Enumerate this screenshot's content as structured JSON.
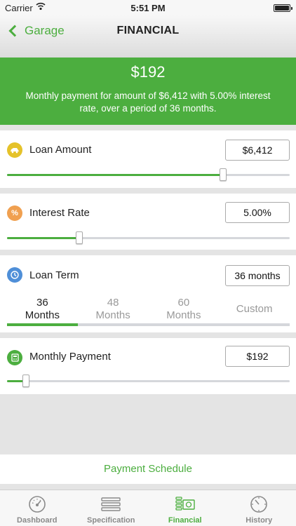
{
  "status_bar": {
    "carrier": "Carrier",
    "time": "5:51 PM"
  },
  "nav": {
    "back_label": "Garage",
    "title": "FINANCIAL"
  },
  "summary": {
    "amount": "$192",
    "description": "Monthly payment for amount of $6,412 with 5.00% interest rate, over a period of 36 months."
  },
  "loan_amount": {
    "label": "Loan Amount",
    "value": "$6,412",
    "slider_fraction": 0.765
  },
  "interest_rate": {
    "label": "Interest Rate",
    "value": "5.00%",
    "slider_fraction": 0.255
  },
  "loan_term": {
    "label": "Loan Term",
    "value": "36 months",
    "options": [
      {
        "line1": "36",
        "line2": "Months",
        "selected": true
      },
      {
        "line1": "48",
        "line2": "Months",
        "selected": false
      },
      {
        "line1": "60",
        "line2": "Months",
        "selected": false
      },
      {
        "line1": "Custom",
        "line2": "",
        "selected": false
      }
    ]
  },
  "monthly_payment": {
    "label": "Monthly Payment",
    "value": "$192",
    "slider_fraction": 0.068
  },
  "payment_schedule_label": "Payment Schedule",
  "tabs": [
    {
      "label": "Dashboard",
      "icon": "dashboard-gauge-icon",
      "active": false
    },
    {
      "label": "Specification",
      "icon": "list-icon",
      "active": false
    },
    {
      "label": "Financial",
      "icon": "money-icon",
      "active": true
    },
    {
      "label": "History",
      "icon": "history-clock-icon",
      "active": false
    }
  ],
  "colors": {
    "accent_green": "#4cae3f",
    "loan_icon": "#e5c22a",
    "interest_icon": "#f0a050",
    "term_icon": "#4f8fd8",
    "payment_icon": "#4cae3f"
  }
}
